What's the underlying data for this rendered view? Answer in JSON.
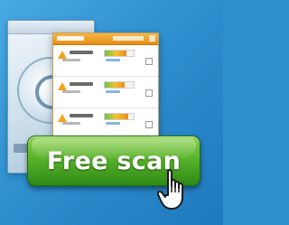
{
  "button": {
    "label": "Free scan"
  },
  "icons": {
    "cursor": "hand-pointer-icon",
    "warning": "warning-triangle-icon"
  },
  "colors": {
    "background": "#2f90cf",
    "button": "#4fa927",
    "panel_header": "#f0a02a"
  }
}
